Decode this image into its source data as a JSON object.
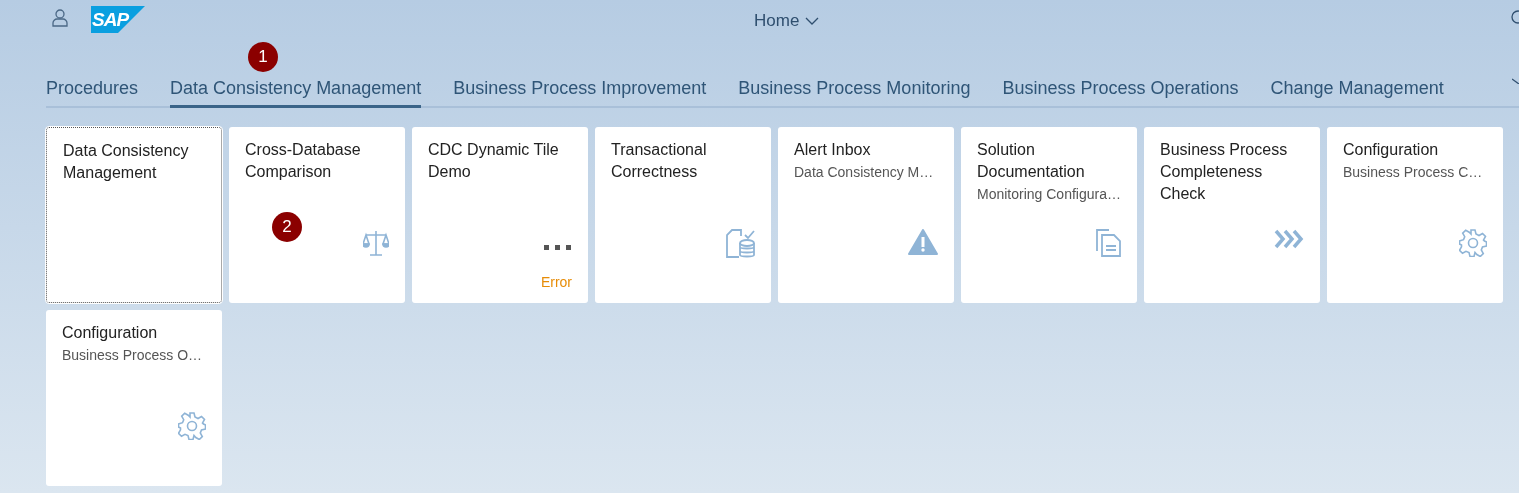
{
  "header": {
    "logo": "SAP",
    "title": "Home"
  },
  "tabs": [
    {
      "label": "Procedures",
      "selected": false
    },
    {
      "label": "Data Consistency Management",
      "selected": true
    },
    {
      "label": "Business Process Improvement",
      "selected": false
    },
    {
      "label": "Business Process Monitoring",
      "selected": false
    },
    {
      "label": "Business Process Operations",
      "selected": false
    },
    {
      "label": "Change Management",
      "selected": false
    }
  ],
  "tiles": [
    {
      "title": "Data Consistency Management",
      "focused": true,
      "kind": "plain"
    },
    {
      "title": "Cross-Database Comparison",
      "focused": false,
      "kind": "scale"
    },
    {
      "title": "CDC Dynamic Tile Demo",
      "focused": false,
      "kind": "dynamic",
      "footer": "Error"
    },
    {
      "title": "Transactional Correctness",
      "focused": false,
      "kind": "database"
    },
    {
      "title": "Alert Inbox",
      "subtitle": "Data Consistency M…",
      "focused": false,
      "kind": "alert"
    },
    {
      "title": "Solution Documentation",
      "subtitle": "Monitoring Configura…",
      "focused": false,
      "kind": "documents"
    },
    {
      "title": "Business Process Completeness Check",
      "focused": false,
      "kind": "process"
    },
    {
      "title": "Configuration",
      "subtitle": "Business Process C…",
      "focused": false,
      "kind": "settings"
    },
    {
      "title": "Configuration",
      "subtitle": "Business Process O…",
      "focused": false,
      "kind": "settings"
    }
  ],
  "callouts": [
    "1",
    "2"
  ]
}
